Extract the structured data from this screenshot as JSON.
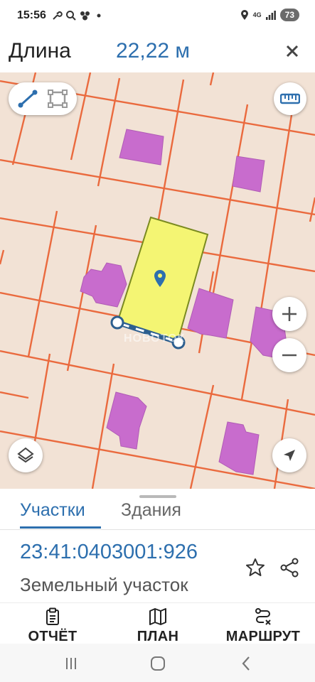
{
  "status_bar": {
    "time": "15:56",
    "network": "4G",
    "battery": "73"
  },
  "header": {
    "label": "Длина",
    "value": "22,22 м"
  },
  "map": {
    "watermark": "НОВОТОК",
    "parcel_color": "#f4f573",
    "building_color": "#c86ccd",
    "boundary_color": "#ea6a3e",
    "accent_color": "#2d5f8f"
  },
  "sheet": {
    "tabs": [
      {
        "label": "Участки",
        "active": true
      },
      {
        "label": "Здания",
        "active": false
      }
    ],
    "cadastral_number": "23:41:0403001:926",
    "parcel_type": "Земельный участок"
  },
  "actions": [
    {
      "label": "ОТЧЁТ",
      "icon": "report-icon"
    },
    {
      "label": "ПЛАН",
      "icon": "map-plan-icon"
    },
    {
      "label": "МАРШРУТ",
      "icon": "route-icon"
    }
  ],
  "icons": [
    "ruler-line-icon",
    "polygon-area-icon",
    "ruler-icon",
    "zoom-in-icon",
    "zoom-out-icon",
    "layers-icon",
    "locate-arrow-icon",
    "map-pin-icon",
    "star-icon",
    "share-icon",
    "recents-icon",
    "home-icon",
    "back-icon"
  ]
}
